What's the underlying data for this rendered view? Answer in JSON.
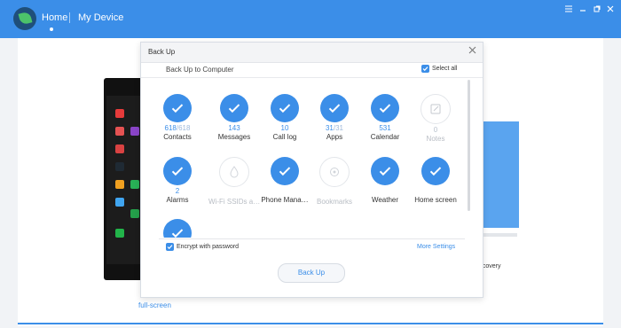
{
  "topbar": {
    "nav_home": "Home",
    "nav_my_device": "My Device"
  },
  "window_controls": {
    "menu_icon": "menu-icon",
    "minimize_icon": "minimize-icon",
    "restore_icon": "restore-icon",
    "close_icon": "close-icon"
  },
  "background": {
    "fullscreen_hint": "full-screen",
    "side_text": "ecovery"
  },
  "modal": {
    "title": "Back Up",
    "section_title": "Back Up to Computer",
    "select_all": "Select all",
    "items": [
      {
        "label": "Contacts",
        "count": "618",
        "total": "618",
        "state": "active"
      },
      {
        "label": "Messages",
        "count": "143",
        "total": "",
        "state": "active"
      },
      {
        "label": "Call log",
        "count": "10",
        "total": "",
        "state": "active"
      },
      {
        "label": "Apps",
        "count": "31",
        "total": "31",
        "state": "active"
      },
      {
        "label": "Calendar",
        "count": "531",
        "total": "",
        "state": "active"
      },
      {
        "label": "Notes",
        "count": "0",
        "total": "",
        "state": "inactive"
      },
      {
        "label": "Alarms",
        "count": "2",
        "total": "",
        "state": "active"
      },
      {
        "label": "Wi-Fi SSIDs a…",
        "count": "",
        "total": "",
        "state": "disabled"
      },
      {
        "label": "Phone Mana…",
        "count": "",
        "total": "",
        "state": "active"
      },
      {
        "label": "Bookmarks",
        "count": "",
        "total": "",
        "state": "disabled"
      },
      {
        "label": "Weather",
        "count": "",
        "total": "",
        "state": "active"
      },
      {
        "label": "Home screen",
        "count": "",
        "total": "",
        "state": "active"
      },
      {
        "label": "",
        "count": "",
        "total": "",
        "state": "active"
      }
    ],
    "encrypt_label": "Encrypt with password",
    "more_settings": "More Settings",
    "backup_button": "Back Up"
  },
  "colors": {
    "accent": "#3b8ee8"
  }
}
